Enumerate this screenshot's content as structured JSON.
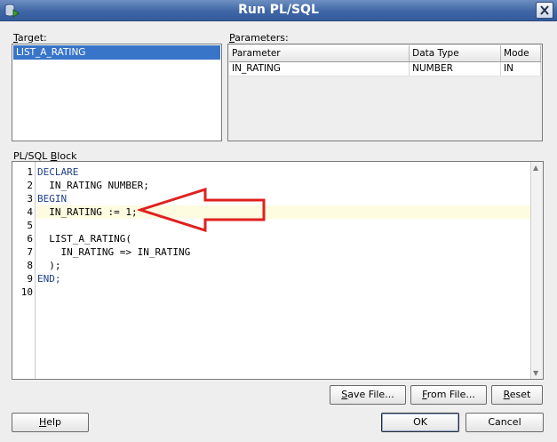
{
  "window": {
    "title": "Run PL/SQL",
    "close_icon": "close-x-icon",
    "app_icon": "database-run-icon"
  },
  "target": {
    "label_mnemonic": "T",
    "label_rest": "arget:",
    "items": [
      "LIST_A_RATING"
    ]
  },
  "parameters": {
    "label_mnemonic": "P",
    "label_rest": "arameters:",
    "columns": [
      "Parameter",
      "Data Type",
      "Mode"
    ],
    "rows": [
      [
        "IN_RATING",
        "NUMBER",
        "IN"
      ]
    ]
  },
  "block": {
    "label_prefix": "PL/SQL ",
    "label_mnemonic": "B",
    "label_rest": "lock",
    "line_numbers": [
      "1",
      "2",
      "3",
      "4",
      "5",
      "6",
      "7",
      "8",
      "9",
      "10"
    ],
    "current_line": 4,
    "lines": [
      "DECLARE",
      "  IN_RATING NUMBER;",
      "BEGIN",
      "  IN_RATING := 1;",
      "",
      "  LIST_A_RATING(",
      "    IN_RATING => IN_RATING",
      "  );",
      "END;",
      ""
    ]
  },
  "buttons": {
    "save_file": {
      "mnemonic": "S",
      "rest": "ave File..."
    },
    "from_file": {
      "mnemonic": "F",
      "rest": "rom File..."
    },
    "reset": {
      "mnemonic": "R",
      "rest": "eset"
    },
    "help": {
      "mnemonic": "H",
      "rest": "elp"
    },
    "ok": "OK",
    "cancel": "Cancel"
  },
  "colors": {
    "title_bar": "#3f66a6",
    "selection": "#3875c8",
    "keyword": "#1e3f8c",
    "current_line": "#fdfbe0",
    "annotation_arrow": "#e02020"
  }
}
